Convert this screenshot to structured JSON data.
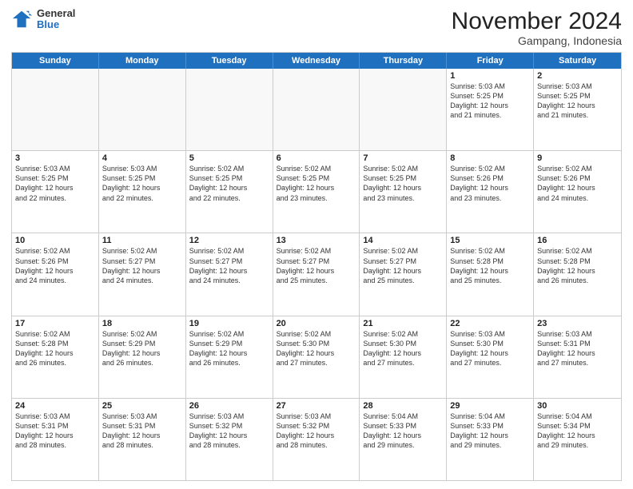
{
  "logo": {
    "general": "General",
    "blue": "Blue"
  },
  "title": {
    "month": "November 2024",
    "location": "Gampang, Indonesia"
  },
  "days_of_week": [
    "Sunday",
    "Monday",
    "Tuesday",
    "Wednesday",
    "Thursday",
    "Friday",
    "Saturday"
  ],
  "weeks": [
    [
      {
        "day": "",
        "info": ""
      },
      {
        "day": "",
        "info": ""
      },
      {
        "day": "",
        "info": ""
      },
      {
        "day": "",
        "info": ""
      },
      {
        "day": "",
        "info": ""
      },
      {
        "day": "1",
        "info": "Sunrise: 5:03 AM\nSunset: 5:25 PM\nDaylight: 12 hours\nand 21 minutes."
      },
      {
        "day": "2",
        "info": "Sunrise: 5:03 AM\nSunset: 5:25 PM\nDaylight: 12 hours\nand 21 minutes."
      }
    ],
    [
      {
        "day": "3",
        "info": "Sunrise: 5:03 AM\nSunset: 5:25 PM\nDaylight: 12 hours\nand 22 minutes."
      },
      {
        "day": "4",
        "info": "Sunrise: 5:03 AM\nSunset: 5:25 PM\nDaylight: 12 hours\nand 22 minutes."
      },
      {
        "day": "5",
        "info": "Sunrise: 5:02 AM\nSunset: 5:25 PM\nDaylight: 12 hours\nand 22 minutes."
      },
      {
        "day": "6",
        "info": "Sunrise: 5:02 AM\nSunset: 5:25 PM\nDaylight: 12 hours\nand 23 minutes."
      },
      {
        "day": "7",
        "info": "Sunrise: 5:02 AM\nSunset: 5:25 PM\nDaylight: 12 hours\nand 23 minutes."
      },
      {
        "day": "8",
        "info": "Sunrise: 5:02 AM\nSunset: 5:26 PM\nDaylight: 12 hours\nand 23 minutes."
      },
      {
        "day": "9",
        "info": "Sunrise: 5:02 AM\nSunset: 5:26 PM\nDaylight: 12 hours\nand 24 minutes."
      }
    ],
    [
      {
        "day": "10",
        "info": "Sunrise: 5:02 AM\nSunset: 5:26 PM\nDaylight: 12 hours\nand 24 minutes."
      },
      {
        "day": "11",
        "info": "Sunrise: 5:02 AM\nSunset: 5:27 PM\nDaylight: 12 hours\nand 24 minutes."
      },
      {
        "day": "12",
        "info": "Sunrise: 5:02 AM\nSunset: 5:27 PM\nDaylight: 12 hours\nand 24 minutes."
      },
      {
        "day": "13",
        "info": "Sunrise: 5:02 AM\nSunset: 5:27 PM\nDaylight: 12 hours\nand 25 minutes."
      },
      {
        "day": "14",
        "info": "Sunrise: 5:02 AM\nSunset: 5:27 PM\nDaylight: 12 hours\nand 25 minutes."
      },
      {
        "day": "15",
        "info": "Sunrise: 5:02 AM\nSunset: 5:28 PM\nDaylight: 12 hours\nand 25 minutes."
      },
      {
        "day": "16",
        "info": "Sunrise: 5:02 AM\nSunset: 5:28 PM\nDaylight: 12 hours\nand 26 minutes."
      }
    ],
    [
      {
        "day": "17",
        "info": "Sunrise: 5:02 AM\nSunset: 5:28 PM\nDaylight: 12 hours\nand 26 minutes."
      },
      {
        "day": "18",
        "info": "Sunrise: 5:02 AM\nSunset: 5:29 PM\nDaylight: 12 hours\nand 26 minutes."
      },
      {
        "day": "19",
        "info": "Sunrise: 5:02 AM\nSunset: 5:29 PM\nDaylight: 12 hours\nand 26 minutes."
      },
      {
        "day": "20",
        "info": "Sunrise: 5:02 AM\nSunset: 5:30 PM\nDaylight: 12 hours\nand 27 minutes."
      },
      {
        "day": "21",
        "info": "Sunrise: 5:02 AM\nSunset: 5:30 PM\nDaylight: 12 hours\nand 27 minutes."
      },
      {
        "day": "22",
        "info": "Sunrise: 5:03 AM\nSunset: 5:30 PM\nDaylight: 12 hours\nand 27 minutes."
      },
      {
        "day": "23",
        "info": "Sunrise: 5:03 AM\nSunset: 5:31 PM\nDaylight: 12 hours\nand 27 minutes."
      }
    ],
    [
      {
        "day": "24",
        "info": "Sunrise: 5:03 AM\nSunset: 5:31 PM\nDaylight: 12 hours\nand 28 minutes."
      },
      {
        "day": "25",
        "info": "Sunrise: 5:03 AM\nSunset: 5:31 PM\nDaylight: 12 hours\nand 28 minutes."
      },
      {
        "day": "26",
        "info": "Sunrise: 5:03 AM\nSunset: 5:32 PM\nDaylight: 12 hours\nand 28 minutes."
      },
      {
        "day": "27",
        "info": "Sunrise: 5:03 AM\nSunset: 5:32 PM\nDaylight: 12 hours\nand 28 minutes."
      },
      {
        "day": "28",
        "info": "Sunrise: 5:04 AM\nSunset: 5:33 PM\nDaylight: 12 hours\nand 29 minutes."
      },
      {
        "day": "29",
        "info": "Sunrise: 5:04 AM\nSunset: 5:33 PM\nDaylight: 12 hours\nand 29 minutes."
      },
      {
        "day": "30",
        "info": "Sunrise: 5:04 AM\nSunset: 5:34 PM\nDaylight: 12 hours\nand 29 minutes."
      }
    ]
  ]
}
